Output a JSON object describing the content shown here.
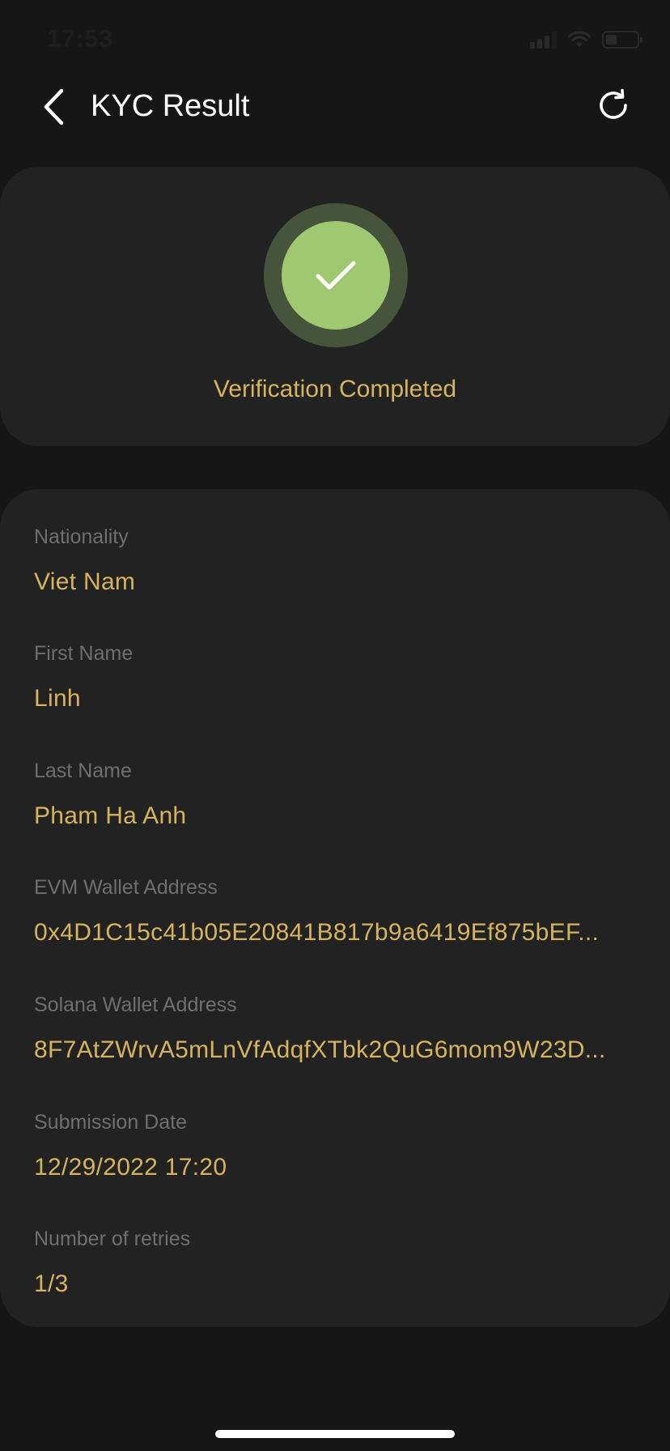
{
  "status_bar": {
    "time": "17:53",
    "battery_level": 0.35
  },
  "header": {
    "title": "KYC Result"
  },
  "result": {
    "status_text": "Verification Completed",
    "colors": {
      "ring": "#46543b",
      "circle": "#a0c870",
      "text": "#d6b45e"
    }
  },
  "details": [
    {
      "label": "Nationality",
      "value": "Viet Nam"
    },
    {
      "label": "First Name",
      "value": "Linh"
    },
    {
      "label": "Last Name",
      "value": "Pham Ha Anh"
    },
    {
      "label": "EVM Wallet Address",
      "value": "0x4D1C15c41b05E20841B817b9a6419Ef875bEF..."
    },
    {
      "label": "Solana Wallet Address",
      "value": "8F7AtZWrvA5mLnVfAdqfXTbk2QuG6mom9W23D..."
    },
    {
      "label": "Submission Date",
      "value": "12/29/2022 17:20"
    },
    {
      "label": "Number of retries",
      "value": "1/3"
    }
  ],
  "icons": {
    "back": "chevron-left-icon",
    "refresh": "refresh-icon",
    "check": "check-icon"
  }
}
